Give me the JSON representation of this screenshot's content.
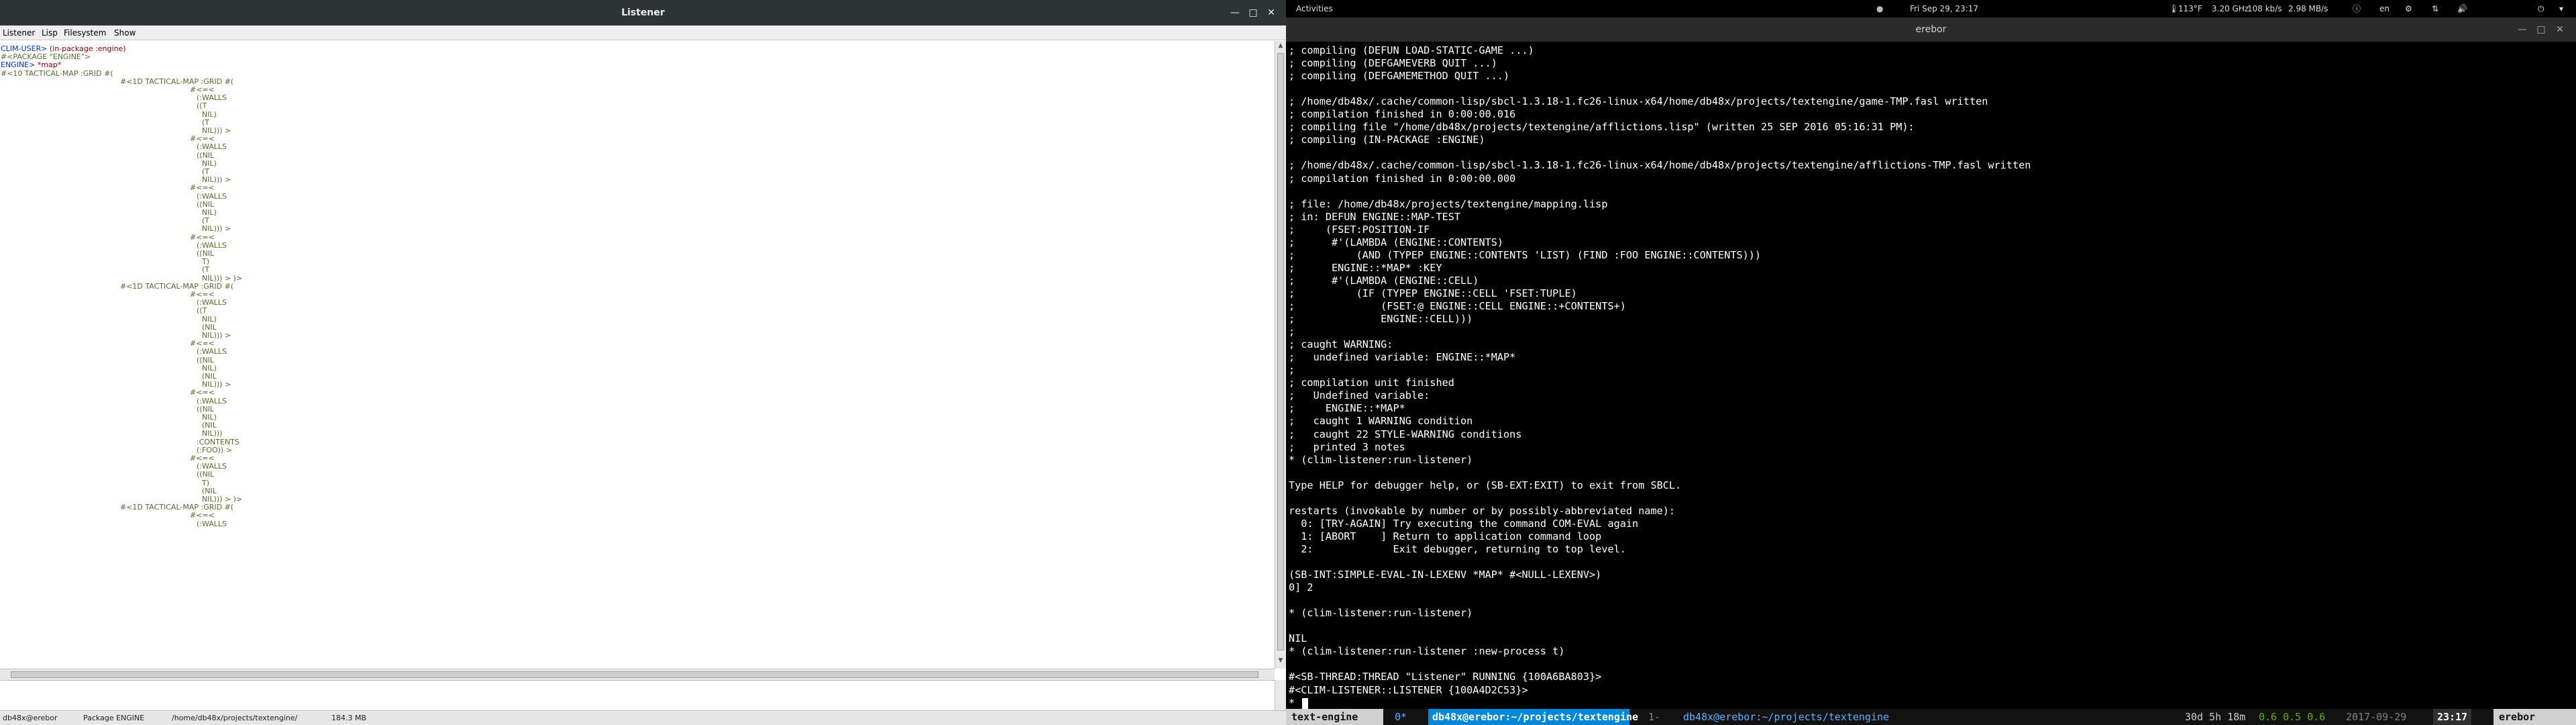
{
  "left_window": {
    "title": "Listener",
    "menu": [
      "Listener",
      "Lisp",
      "Filesystem",
      "Show"
    ],
    "listener_lines": [
      {
        "text": "CLIM-USER> ",
        "cls": "c-prompt",
        "indent": 0,
        "tail": "(in-package :engine)",
        "tail_cls": "c-input"
      },
      {
        "text": "#<PACKAGE \"ENGINE\">",
        "cls": "c-out",
        "indent": 0
      },
      {
        "text": "ENGINE> ",
        "cls": "c-prompt",
        "indent": 0,
        "tail": "*map*",
        "tail_cls": "c-input"
      },
      {
        "text": "#<10 TACTICAL-MAP :GRID #(",
        "cls": "c-out",
        "indent": 0
      },
      {
        "text": "#<1D TACTICAL-MAP :GRID #(",
        "cls": "c-out",
        "indent": 1
      },
      {
        "text": "#<=<",
        "cls": "c-out",
        "indent": 2
      },
      {
        "text": "(:WALLS",
        "cls": "c-out",
        "indent": 3
      },
      {
        "text": "((T",
        "cls": "c-out",
        "indent": 3
      },
      {
        "text": "NIL)",
        "cls": "c-out",
        "indent": 4
      },
      {
        "text": "(T",
        "cls": "c-out",
        "indent": 4
      },
      {
        "text": "NIL))) >",
        "cls": "c-out",
        "indent": 4
      },
      {
        "text": "#<=<",
        "cls": "c-out",
        "indent": 2
      },
      {
        "text": "(:WALLS",
        "cls": "c-out",
        "indent": 3
      },
      {
        "text": "((NIL",
        "cls": "c-out",
        "indent": 3
      },
      {
        "text": "NIL)",
        "cls": "c-out",
        "indent": 4
      },
      {
        "text": "(T",
        "cls": "c-out",
        "indent": 4
      },
      {
        "text": "NIL))) >",
        "cls": "c-out",
        "indent": 4
      },
      {
        "text": "#<=<",
        "cls": "c-out",
        "indent": 2
      },
      {
        "text": "(:WALLS",
        "cls": "c-out",
        "indent": 3
      },
      {
        "text": "((NIL",
        "cls": "c-out",
        "indent": 3
      },
      {
        "text": "NIL)",
        "cls": "c-out",
        "indent": 4
      },
      {
        "text": "(T",
        "cls": "c-out",
        "indent": 4
      },
      {
        "text": "NIL))) >",
        "cls": "c-out",
        "indent": 4
      },
      {
        "text": "#<=<",
        "cls": "c-out",
        "indent": 2
      },
      {
        "text": "(:WALLS",
        "cls": "c-out",
        "indent": 3
      },
      {
        "text": "((NIL",
        "cls": "c-out",
        "indent": 3
      },
      {
        "text": "T)",
        "cls": "c-out",
        "indent": 4
      },
      {
        "text": "(T",
        "cls": "c-out",
        "indent": 4
      },
      {
        "text": "NIL))) > )>",
        "cls": "c-out",
        "indent": 4
      },
      {
        "text": "#<1D TACTICAL-MAP :GRID #(",
        "cls": "c-out",
        "indent": 1
      },
      {
        "text": "#<=<",
        "cls": "c-out",
        "indent": 2
      },
      {
        "text": "(:WALLS",
        "cls": "c-out",
        "indent": 3
      },
      {
        "text": "((T",
        "cls": "c-out",
        "indent": 3
      },
      {
        "text": "NIL)",
        "cls": "c-out",
        "indent": 4
      },
      {
        "text": "(NIL",
        "cls": "c-out",
        "indent": 4
      },
      {
        "text": "NIL))) >",
        "cls": "c-out",
        "indent": 4
      },
      {
        "text": "#<=<",
        "cls": "c-out",
        "indent": 2
      },
      {
        "text": "(:WALLS",
        "cls": "c-out",
        "indent": 3
      },
      {
        "text": "((NIL",
        "cls": "c-out",
        "indent": 3
      },
      {
        "text": "NIL)",
        "cls": "c-out",
        "indent": 4
      },
      {
        "text": "(NIL",
        "cls": "c-out",
        "indent": 4
      },
      {
        "text": "NIL))) >",
        "cls": "c-out",
        "indent": 4
      },
      {
        "text": "#<=<",
        "cls": "c-out",
        "indent": 2
      },
      {
        "text": "(:WALLS",
        "cls": "c-out",
        "indent": 3
      },
      {
        "text": "((NIL",
        "cls": "c-out",
        "indent": 3
      },
      {
        "text": "NIL)",
        "cls": "c-out",
        "indent": 4
      },
      {
        "text": "(NIL",
        "cls": "c-out",
        "indent": 4
      },
      {
        "text": "NIL)))",
        "cls": "c-out",
        "indent": 4
      },
      {
        "text": ":CONTENTS",
        "cls": "c-out",
        "indent": 3
      },
      {
        "text": "(:FOO)) >",
        "cls": "c-out",
        "indent": 3
      },
      {
        "text": "#<=<",
        "cls": "c-out",
        "indent": 2
      },
      {
        "text": "(:WALLS",
        "cls": "c-out",
        "indent": 3
      },
      {
        "text": "((NIL",
        "cls": "c-out",
        "indent": 3
      },
      {
        "text": "T)",
        "cls": "c-out",
        "indent": 4
      },
      {
        "text": "(NIL",
        "cls": "c-out",
        "indent": 4
      },
      {
        "text": "NIL))) > )>",
        "cls": "c-out",
        "indent": 4
      },
      {
        "text": "#<1D TACTICAL-MAP :GRID #(",
        "cls": "c-out",
        "indent": 1
      },
      {
        "text": "#<=<",
        "cls": "c-out",
        "indent": 2
      },
      {
        "text": "(:WALLS",
        "cls": "c-out",
        "indent": 3
      }
    ],
    "status": {
      "user": "db48x@erebor",
      "package": "Package ENGINE",
      "directory": "/home/db48x/projects/textengine/",
      "memory": "184.3 MB"
    }
  },
  "topbar": {
    "activities": "Activities",
    "clock": "Fri Sep 29, 23:17",
    "temperature": "113°F",
    "cpu": "3.20 GHz",
    "net_down": "108 kb/s",
    "net_up": "2.98 MB/s",
    "keyboard": "en"
  },
  "terminal": {
    "title": "erebor",
    "lines": [
      "; compiling (DEFUN LOAD-STATIC-GAME ...)",
      "; compiling (DEFGAMEVERB QUIT ...)",
      "; compiling (DEFGAMEMETHOD QUIT ...)",
      "",
      "; /home/db48x/.cache/common-lisp/sbcl-1.3.18-1.fc26-linux-x64/home/db48x/projects/textengine/game-TMP.fasl written",
      "; compilation finished in 0:00:00.016",
      "; compiling file \"/home/db48x/projects/textengine/afflictions.lisp\" (written 25 SEP 2016 05:16:31 PM):",
      "; compiling (IN-PACKAGE :ENGINE)",
      "",
      "; /home/db48x/.cache/common-lisp/sbcl-1.3.18-1.fc26-linux-x64/home/db48x/projects/textengine/afflictions-TMP.fasl written",
      "; compilation finished in 0:00:00.000",
      "",
      "; file: /home/db48x/projects/textengine/mapping.lisp",
      "; in: DEFUN ENGINE::MAP-TEST",
      ";     (FSET:POSITION-IF",
      ";      #'(LAMBDA (ENGINE::CONTENTS)",
      ";          (AND (TYPEP ENGINE::CONTENTS 'LIST) (FIND :FOO ENGINE::CONTENTS)))",
      ";      ENGINE::*MAP* :KEY",
      ";      #'(LAMBDA (ENGINE::CELL)",
      ";          (IF (TYPEP ENGINE::CELL 'FSET:TUPLE)",
      ";              (FSET:@ ENGINE::CELL ENGINE::+CONTENTS+)",
      ";              ENGINE::CELL)))",
      ";",
      "; caught WARNING:",
      ";   undefined variable: ENGINE::*MAP*",
      ";",
      "; compilation unit finished",
      ";   Undefined variable:",
      ";     ENGINE::*MAP*",
      ";   caught 1 WARNING condition",
      ";   caught 22 STYLE-WARNING conditions",
      ";   printed 3 notes",
      "* (clim-listener:run-listener)",
      "",
      "Type HELP for debugger help, or (SB-EXT:EXIT) to exit from SBCL.",
      "",
      "restarts (invokable by number or by possibly-abbreviated name):",
      "  0: [TRY-AGAIN] Try executing the command COM-EVAL again",
      "  1: [ABORT    ] Return to application command loop",
      "  2:             Exit debugger, returning to top level.",
      "",
      "(SB-INT:SIMPLE-EVAL-IN-LEXENV *MAP* #<NULL-LEXENV>)",
      "0] 2",
      "",
      "* (clim-listener:run-listener)",
      "",
      "NIL",
      "* (clim-listener:run-listener :new-process t)",
      "",
      "#<SB-THREAD:THREAD \"Listener\" RUNNING {100A6BA803}>",
      "#<CLIM-LISTENER::LISTENER {100A4D2C53}>",
      "* "
    ]
  },
  "tmux": {
    "session": "text-engine",
    "win0_index": "0*",
    "win0_title": "db48x@erebor:~/projects/textengine",
    "win1_index": "1-",
    "win1_title": "db48x@erebor:~/projects/textengine",
    "uptime": "30d 5h 18m",
    "load": "0.6 0.5 0.6",
    "date": "2017-09-29",
    "time": "23:17",
    "host": "erebor",
    "colors": {
      "session_bg": "#d0d0d0",
      "win0_bg": "#0087d7",
      "accent": "#5fafff",
      "load": "#5faf00"
    }
  }
}
